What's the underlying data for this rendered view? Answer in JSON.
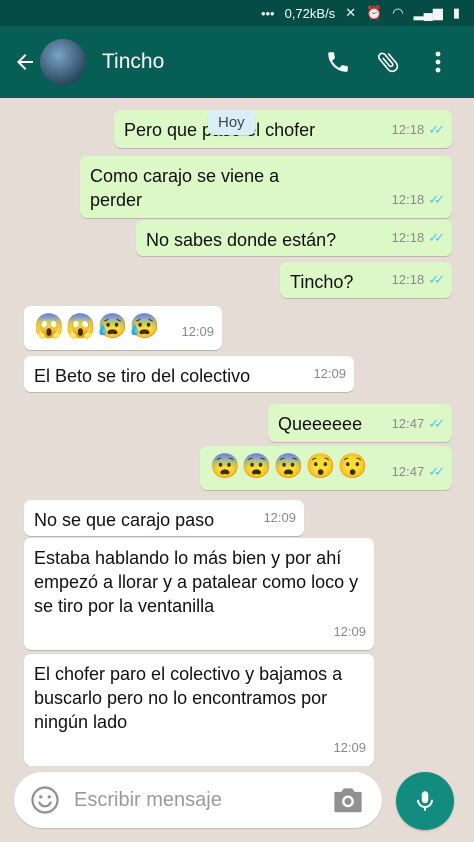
{
  "status_bar": {
    "speed": "0,72kB/s"
  },
  "header": {
    "contact_name": "Tincho"
  },
  "date_chip": "Hoy",
  "messages": [
    {
      "dir": "out",
      "text": "Pero que pasó el chofer",
      "time": "12:18"
    },
    {
      "dir": "out",
      "text": "Como carajo se viene a perder",
      "time": "12:18"
    },
    {
      "dir": "out",
      "text": "No sabes donde están?",
      "time": "12:18"
    },
    {
      "dir": "out",
      "text": "Tincho?",
      "time": "12:18"
    },
    {
      "dir": "in",
      "text": "😱😱😰😰",
      "time": "12:09"
    },
    {
      "dir": "in",
      "text": "El Beto se tiro del colectivo",
      "time": "12:09"
    },
    {
      "dir": "out",
      "text": "Queeeeee",
      "time": "12:47"
    },
    {
      "dir": "out",
      "text": "😨😨😨😯😯",
      "time": "12:47"
    },
    {
      "dir": "in",
      "text": "No se que carajo paso",
      "time": "12:09"
    },
    {
      "dir": "in",
      "text": "Estaba hablando lo más bien y por ahí empezó a llorar y a patalear como loco y se tiro por la ventanilla",
      "time": "12:09"
    },
    {
      "dir": "in",
      "text": "El chofer paro el colectivo y bajamos a buscarlo pero no lo encontramos por ningún lado",
      "time": "12:09"
    }
  ],
  "composer": {
    "placeholder": "Escribir mensaje"
  },
  "colors": {
    "header": "#075e54",
    "outgoing": "#dcf8c6",
    "incoming": "#ffffff",
    "ticks": "#4fc3f7",
    "fab": "#128c7e"
  }
}
